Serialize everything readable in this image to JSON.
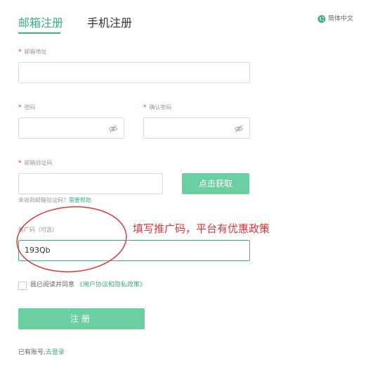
{
  "tabs": {
    "email": "邮箱注册",
    "phone": "手机注册"
  },
  "language": {
    "label": "简体中文",
    "icon": "globe-icon"
  },
  "fields": {
    "email": {
      "required_mark": "*",
      "label": "邮箱地址",
      "value": ""
    },
    "password": {
      "required_mark": "*",
      "label": "密码",
      "value": "",
      "icon": "eye-off-icon"
    },
    "confirm_password": {
      "required_mark": "*",
      "label": "确认密码",
      "value": "",
      "icon": "eye-off-icon"
    },
    "email_code": {
      "required_mark": "*",
      "label": "邮箱验证码",
      "value": ""
    },
    "promo_code": {
      "label": "推广码（可选）",
      "value": "193Qb"
    }
  },
  "buttons": {
    "get_code": "点击获取",
    "register": "注册"
  },
  "help": {
    "text": "未收到邮箱验证码？",
    "link": "需要帮助"
  },
  "agreement": {
    "text": "我已阅读并同意",
    "link": "《用户协议和隐私政策》"
  },
  "login": {
    "text": "已有账号,",
    "link": "去登录"
  },
  "annotation": {
    "text": "填写推广码，平台有优惠政策"
  },
  "colors": {
    "accent": "#3fae84",
    "button": "#6ccfa2",
    "required": "#e2363a",
    "annotation": "#e2363a"
  }
}
